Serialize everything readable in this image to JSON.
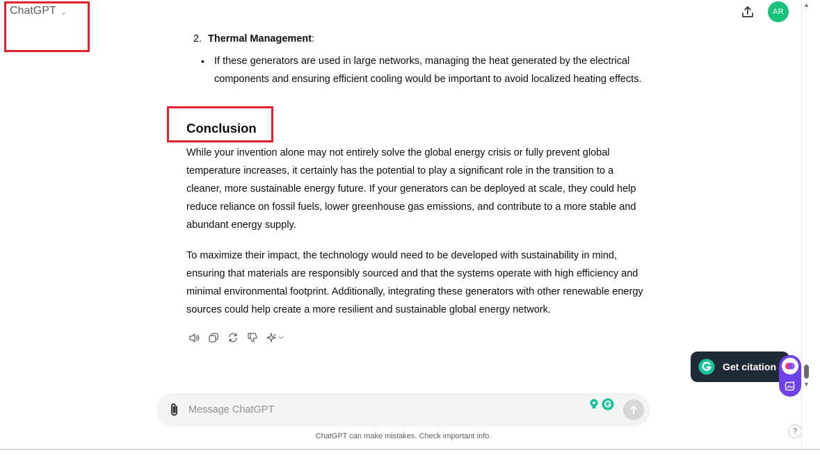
{
  "header": {
    "model_label": "ChatGPT",
    "avatar_initials": "AR"
  },
  "message": {
    "list_number": "2.",
    "list_title": "Thermal Management",
    "list_title_suffix": ":",
    "bullet_text": "If these generators are used in large networks, managing the heat generated by the electrical components and ensuring efficient cooling would be important to avoid localized heating effects.",
    "heading": "Conclusion",
    "paragraph1": "While your invention alone may not entirely solve the global energy crisis or fully prevent global temperature increases, it certainly has the potential to play a significant role in the transition to a cleaner, more sustainable energy future. If your generators can be deployed at scale, they could help reduce reliance on fossil fuels, lower greenhouse gas emissions, and contribute to a more stable and abundant energy supply.",
    "paragraph2": "To maximize their impact, the technology would need to be developed with sustainability in mind, ensuring that materials are responsibly sourced and that the systems operate with high efficiency and minimal environmental footprint. Additionally, integrating these generators with other renewable energy sources could help create a more resilient and sustainable global energy network."
  },
  "message_actions": [
    {
      "icon": "speaker-icon"
    },
    {
      "icon": "copy-icon"
    },
    {
      "icon": "regenerate-icon"
    },
    {
      "icon": "thumbs-down-icon"
    },
    {
      "icon": "sparkle-icon"
    }
  ],
  "composer": {
    "placeholder": "Message ChatGPT"
  },
  "footer": {
    "disclaimer": "ChatGPT can make mistakes. Check important info.",
    "help_label": "?"
  },
  "grammarly": {
    "citation_label": "Get citation"
  },
  "colors": {
    "annotation_red": "#e0202a",
    "avatar_green": "#19c37d",
    "grammarly_green": "#15c39a",
    "grammarly_dark": "#1f2a37",
    "grammarly_purple": "#6d42e6"
  }
}
